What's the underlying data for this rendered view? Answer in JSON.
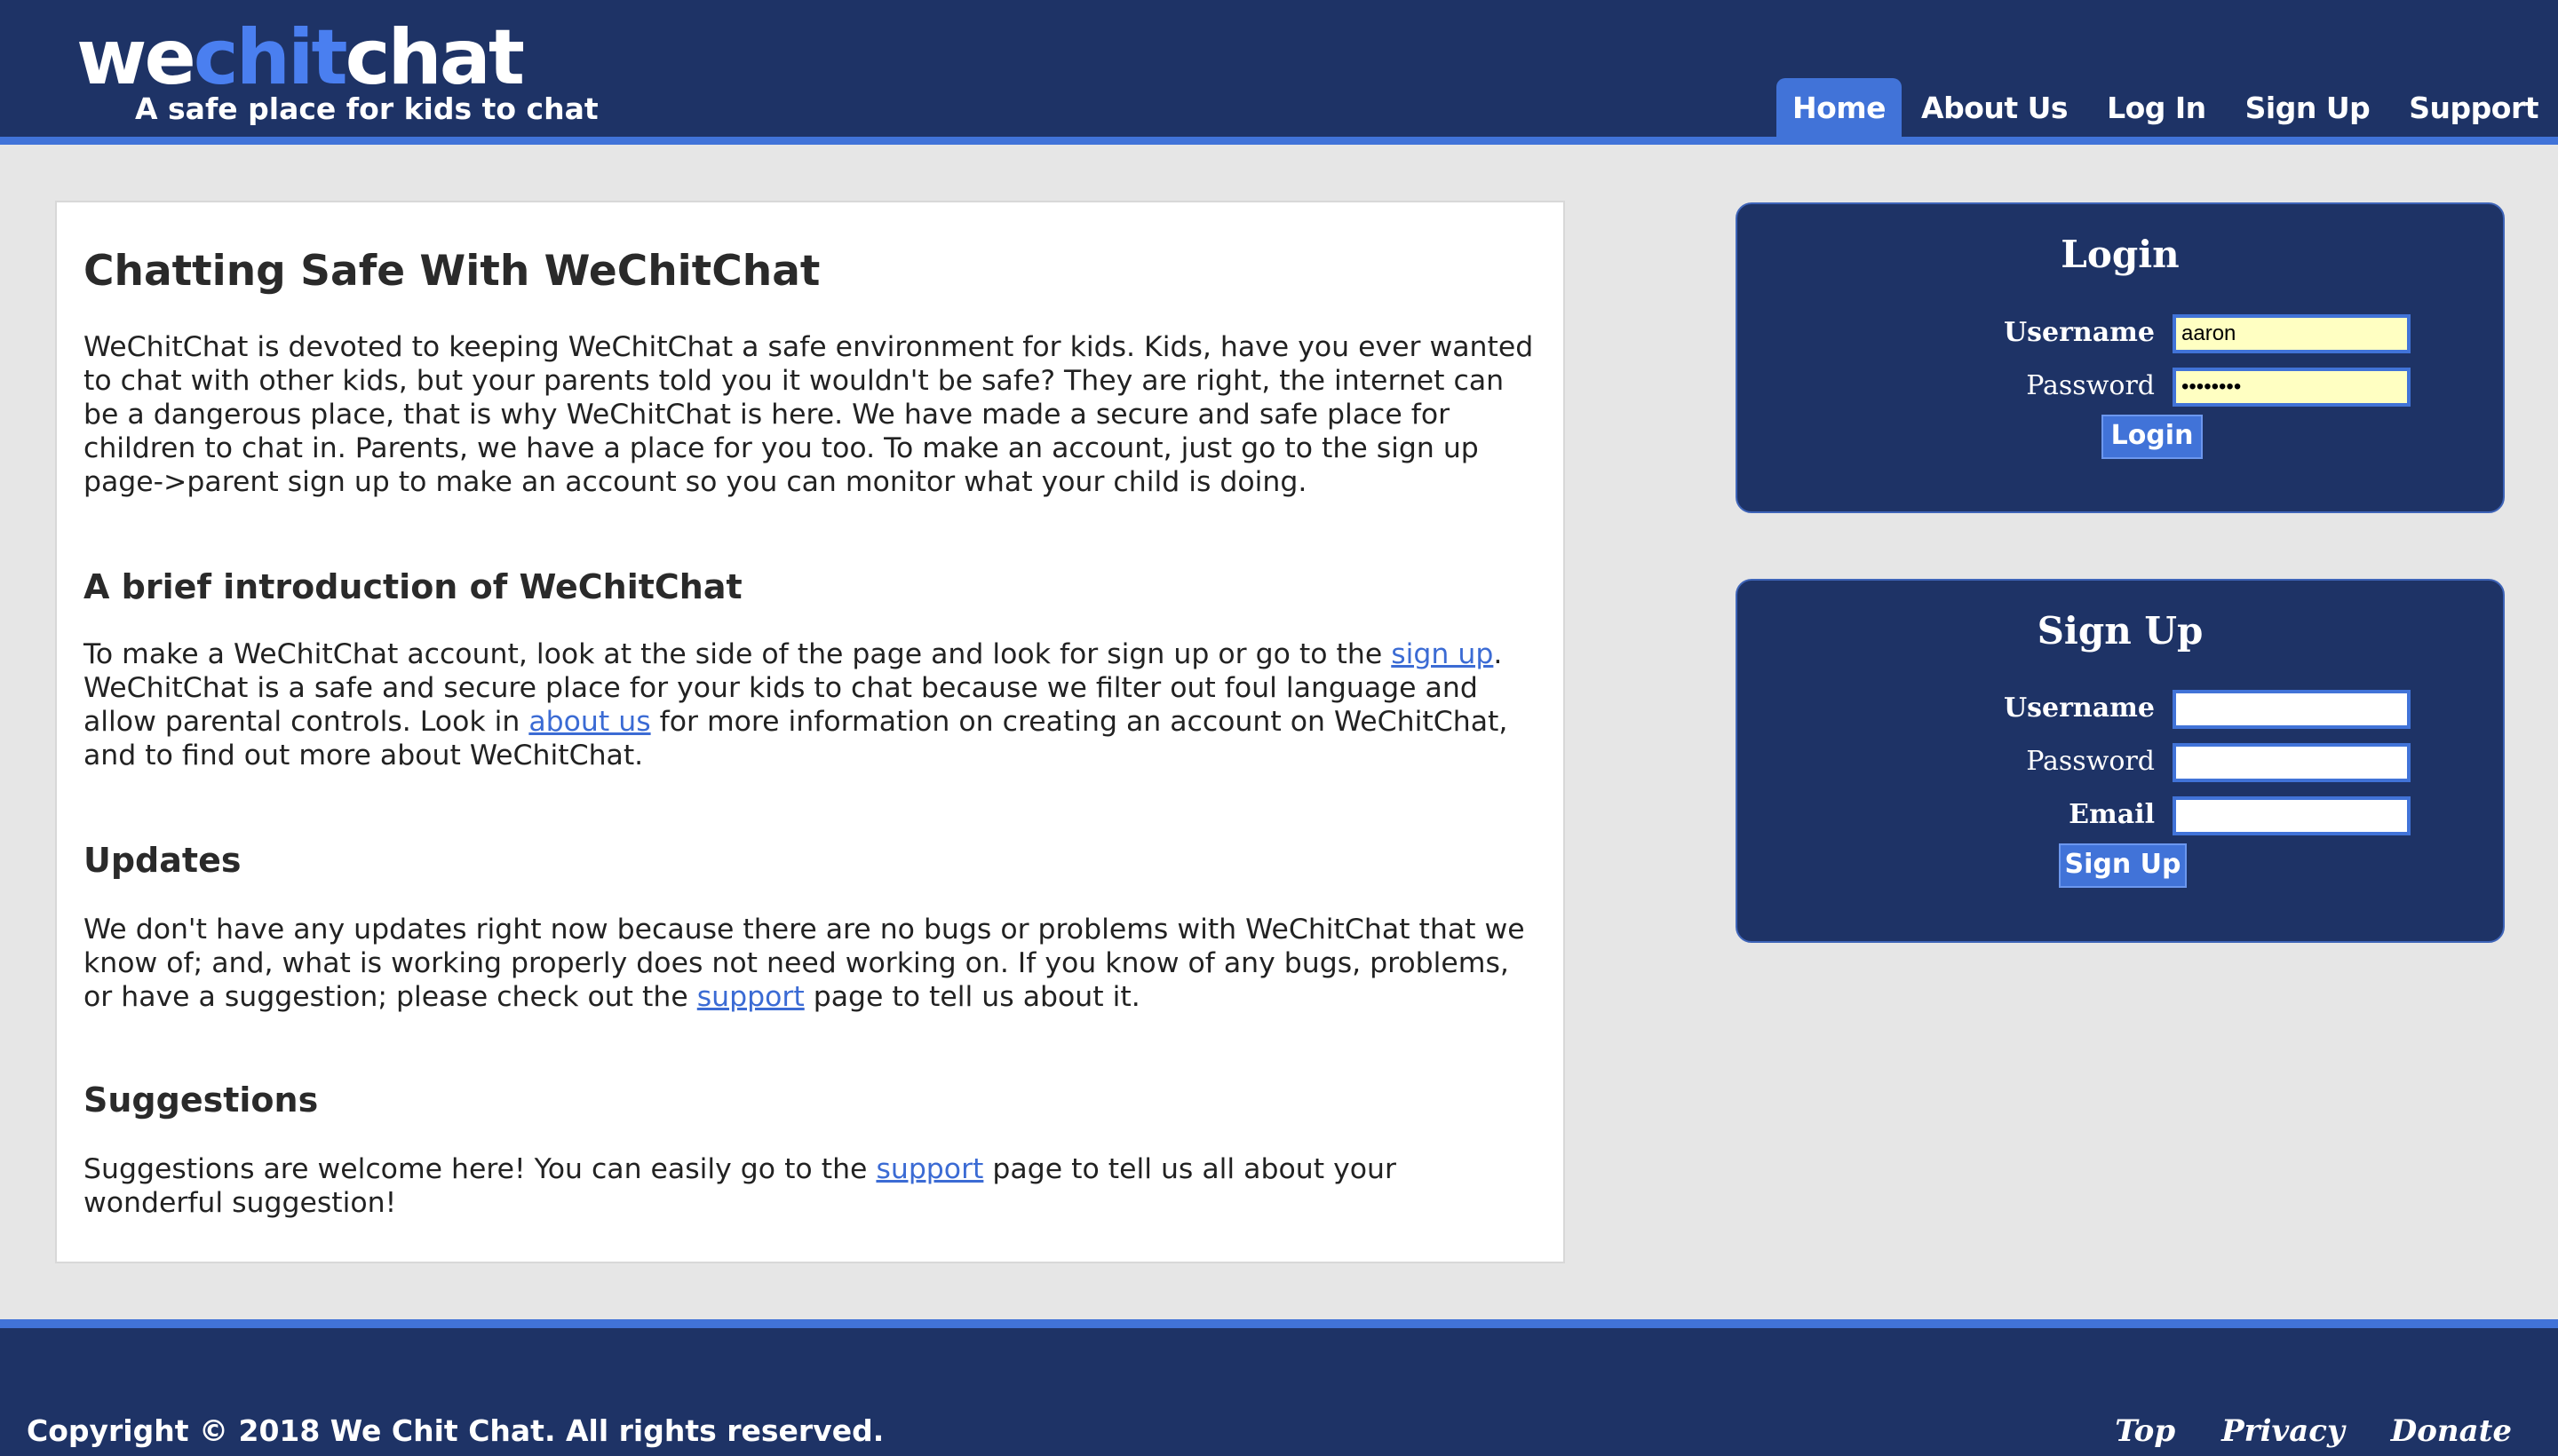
{
  "header": {
    "logo_part1": "we",
    "logo_part2": "chit",
    "logo_part3": "chat",
    "tagline": "A safe place for kids to chat",
    "nav": [
      "Home",
      "About Us",
      "Log In",
      "Sign Up",
      "Support"
    ],
    "active_nav": "Home"
  },
  "article": {
    "title": "Chatting Safe With WeChitChat",
    "intro": "WeChitChat is devoted to keeping WeChitChat a safe environment for kids. Kids, have you ever wanted to chat with other kids, but your parents told you it wouldn't be safe? They are right, the internet can be a dangerous place, that is why WeChitChat is here. We have made a secure and safe place for children to chat in. Parents, we have a place for you too. To make an account, just go to the sign up page->parent sign up to make an account so you can monitor what your child is doing.",
    "section1": {
      "heading": "A brief introduction of WeChitChat",
      "text_a": "To make a WeChitChat account, look at the side of the page and look for sign up or go to the ",
      "link_a": "sign up",
      "text_b": ". WeChitChat is a safe and secure place for your kids to chat because we filter out foul language and allow parental controls. Look in ",
      "link_b": "about us",
      "text_c": " for more information on creating an account on WeChitChat, and to find out more about WeChitChat."
    },
    "section2": {
      "heading": "Updates",
      "text_a": "We don't have any updates right now because there are no bugs or problems with WeChitChat that we know of; and, what is working properly does not need working on. If you know of any bugs, problems, or have a suggestion; please check out the ",
      "link_a": "support",
      "text_b": " page to tell us about it."
    },
    "section3": {
      "heading": "Suggestions",
      "text_a": "Suggestions are welcome here! You can easily go to the ",
      "link_a": "support",
      "text_b": " page to tell us all about your wonderful suggestion!"
    }
  },
  "login": {
    "title": "Login",
    "username_label": "Username",
    "username_value": "aaron",
    "password_label": "Password",
    "password_value": "••••••••",
    "button": "Login"
  },
  "signup": {
    "title": "Sign Up",
    "username_label": "Username",
    "password_label": "Password",
    "email_label": "Email",
    "button": "Sign Up"
  },
  "footer": {
    "copyright": "Copyright © 2018 We Chit Chat. All rights reserved.",
    "links": [
      "Top",
      "Privacy",
      "Donate"
    ]
  },
  "colors": {
    "navy": "#1e3366",
    "accent_blue": "#4173d8",
    "page_bg": "#e6e6e6",
    "input_autofill": "#ffffc2",
    "link": "#3b6bd4"
  }
}
